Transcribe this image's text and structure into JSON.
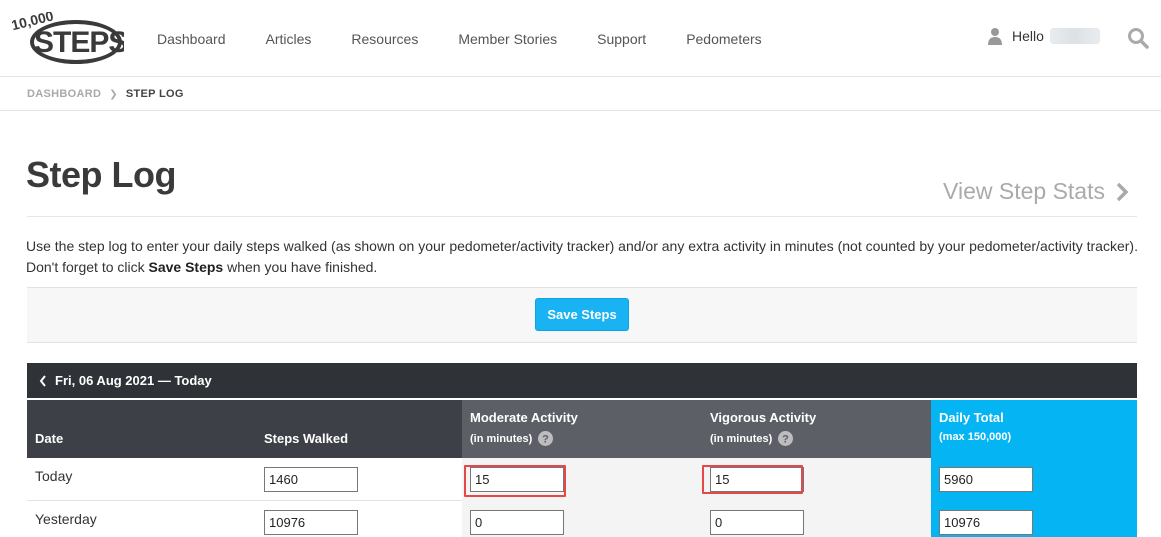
{
  "header": {
    "logo_alt": "10,000 STEPS",
    "nav": [
      "Dashboard",
      "Articles",
      "Resources",
      "Member Stories",
      "Support",
      "Pedometers"
    ],
    "greeting": "Hello"
  },
  "breadcrumb": {
    "parent": "DASHBOARD",
    "current": "STEP LOG"
  },
  "page": {
    "title": "Step Log",
    "view_stats": "View Step Stats",
    "intro_before": "Use the step log to enter your daily steps walked (as shown on your pedometer/activity tracker) and/or any extra activity in minutes (not counted by your pedometer/activity tracker). Don't forget to click ",
    "intro_bold": "Save Steps",
    "intro_after": " when you have finished.",
    "save_label": "Save Steps"
  },
  "table": {
    "date_nav": "Fri, 06 Aug 2021 — Today",
    "headers": {
      "date": "Date",
      "steps": "Steps Walked",
      "moderate": "Moderate Activity",
      "moderate_sub": "(in minutes)",
      "vigorous": "Vigorous Activity",
      "vigorous_sub": "(in minutes)",
      "total": "Daily Total",
      "total_sub": "(max 150,000)"
    },
    "rows": [
      {
        "date": "Today",
        "steps": "1460",
        "moderate": "15",
        "vigorous": "15",
        "total": "5960"
      },
      {
        "date": "Yesterday",
        "steps": "10976",
        "moderate": "0",
        "vigorous": "0",
        "total": "10976"
      }
    ]
  },
  "colors": {
    "accent": "#19b2f3",
    "header_dark": "#3d4046",
    "header_mid": "#5c5f66",
    "total_blue": "#05b4f3",
    "highlight": "#e54848"
  },
  "icons": [
    "logo",
    "user-icon",
    "search-icon",
    "chevron-right-icon",
    "chevron-left-icon",
    "help-icon"
  ]
}
